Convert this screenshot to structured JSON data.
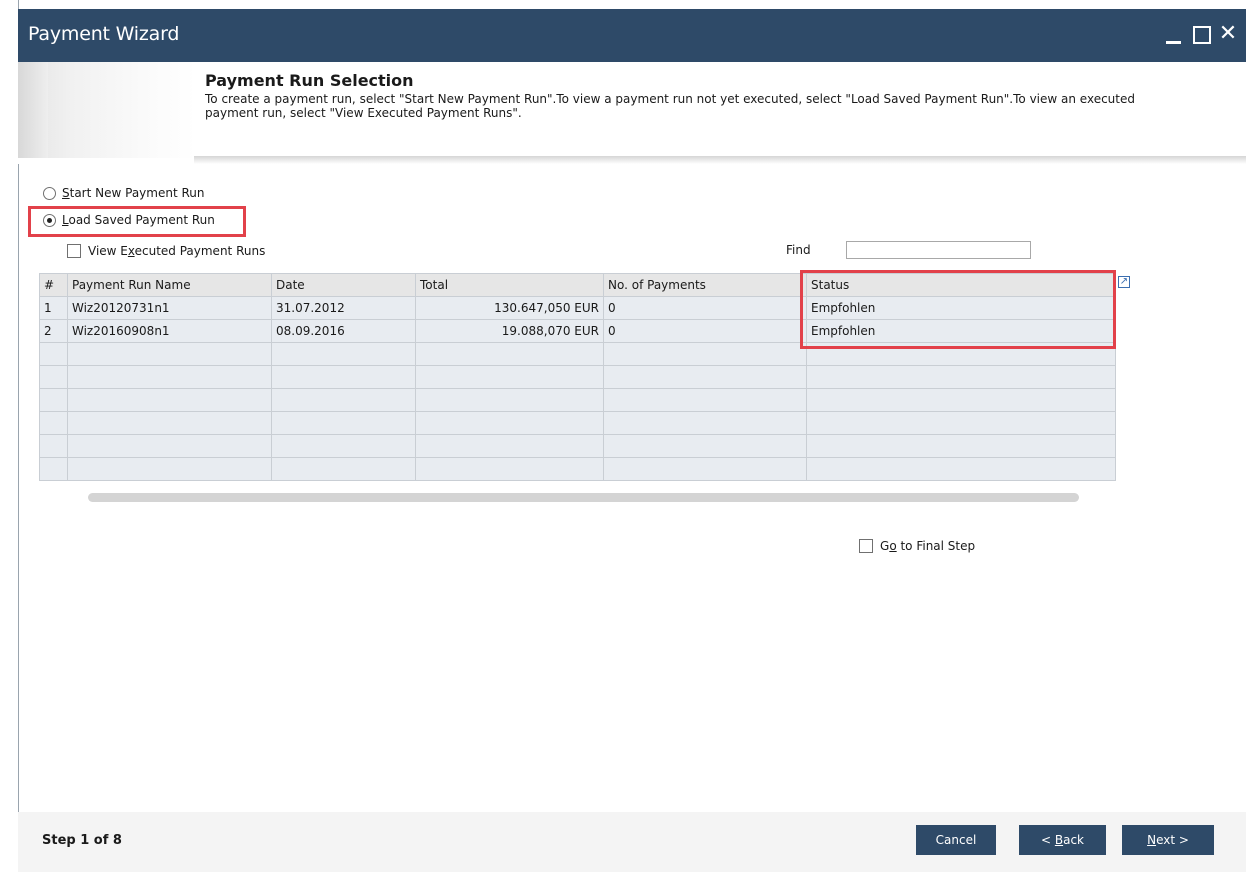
{
  "window": {
    "title": "Payment Wizard",
    "close_glyph": "✕"
  },
  "header": {
    "title": "Payment Run Selection",
    "description": "To create a payment run, select \"Start New Payment Run\".To view a payment run not yet executed, select \"Load Saved Payment Run\".To view an executed payment run, select \"View Executed Payment Runs\"."
  },
  "options": {
    "start_new": {
      "first": "S",
      "rest": "tart New Payment Run",
      "selected": false
    },
    "load_saved": {
      "first": "L",
      "rest": "oad Saved Payment Run",
      "selected": true
    },
    "view_executed": {
      "pre": "View E",
      "u": "x",
      "post": "ecuted Payment Runs",
      "checked": false
    }
  },
  "find": {
    "label": "Find",
    "value": ""
  },
  "grid": {
    "columns": [
      "#",
      "Payment Run Name",
      "Date",
      "Total",
      "No. of Payments",
      "Status"
    ],
    "rows": [
      [
        "1",
        "Wiz20120731n1",
        "31.07.2012",
        "130.647,050 EUR",
        "0",
        "Empfohlen"
      ],
      [
        "2",
        "Wiz20160908n1",
        "08.09.2016",
        "19.088,070 EUR",
        "0",
        "Empfohlen"
      ]
    ],
    "empty_rows": 6
  },
  "final_step": {
    "pre": "G",
    "u": "o",
    "post": " to Final Step",
    "checked": false
  },
  "footer": {
    "step": "Step 1 of 8",
    "cancel": "Cancel",
    "back_pre": "< ",
    "back_u": "B",
    "back_post": "ack",
    "next_u": "N",
    "next_post": "ext >"
  },
  "colors": {
    "titlebar": "#2e4a68",
    "accent_strip": "#e3a12a",
    "highlight": "#e2414a",
    "grid_row": "#e8ecf1"
  }
}
